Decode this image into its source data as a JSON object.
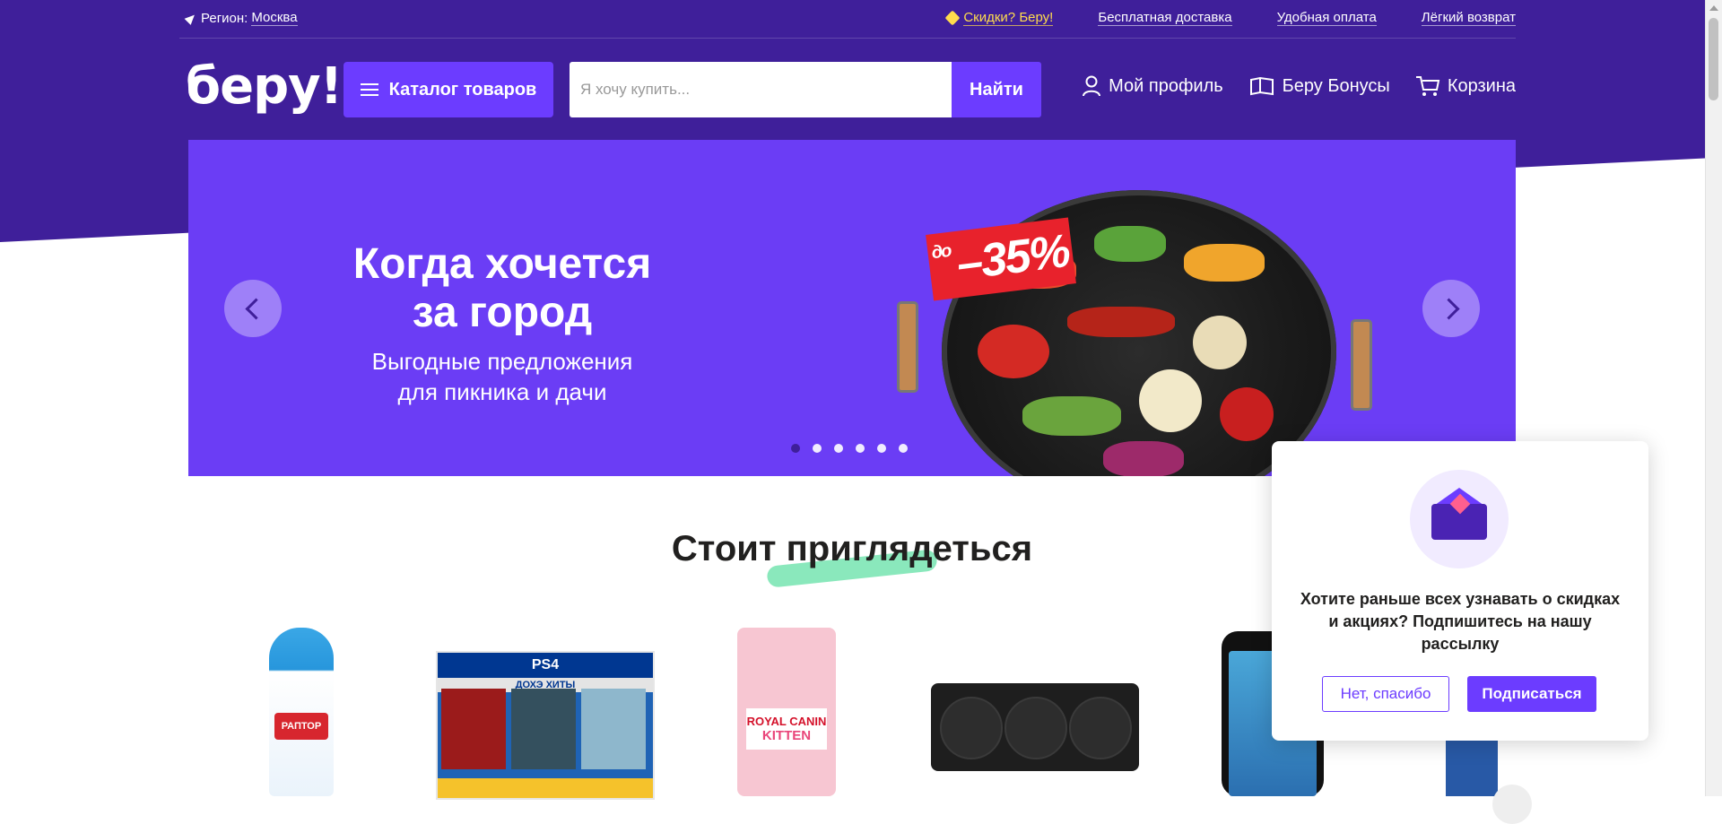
{
  "topbar": {
    "region_label": "Регион:",
    "region_value": "Москва",
    "promo": "Скидки? Беру!",
    "free_delivery": "Бесплатная доставка",
    "payment": "Удобная оплата",
    "return": "Лёгкий возврат"
  },
  "header": {
    "logo": "беру!",
    "catalog": "Каталог товаров",
    "search_placeholder": "Я хочу купить...",
    "search_button": "Найти",
    "profile": "Мой профиль",
    "bonuses": "Беру Бонусы",
    "cart": "Корзина"
  },
  "banner": {
    "title_line1": "Когда хочется",
    "title_line2": "за город",
    "subtitle_line1": "Выгодные предложения",
    "subtitle_line2": "для пикника и дачи",
    "discount_prefix": "до",
    "discount": "–35%",
    "slides_total": 6,
    "active_slide": 1
  },
  "section": {
    "title": "Стоит приглядеться"
  },
  "products": {
    "spray_brand": "РАПТОР",
    "ps4_brand": "PS4",
    "ps4_title": "ДОХЭ ХИТЫ",
    "royal_brand": "ROYAL CANIN",
    "royal_variant": "KITTEN"
  },
  "popup": {
    "text": "Хотите раньше всех узнавать о скидках и акциях? Подпишитесь на нашу рассылку",
    "decline": "Нет, спасибо",
    "accept": "Подписаться"
  },
  "colors": {
    "brand_dark": "#3f1f9a",
    "brand_accent": "#6c3cff",
    "promo_yellow": "#ffdc4d",
    "sale_red": "#e8222c",
    "mint": "#7de6b5"
  }
}
